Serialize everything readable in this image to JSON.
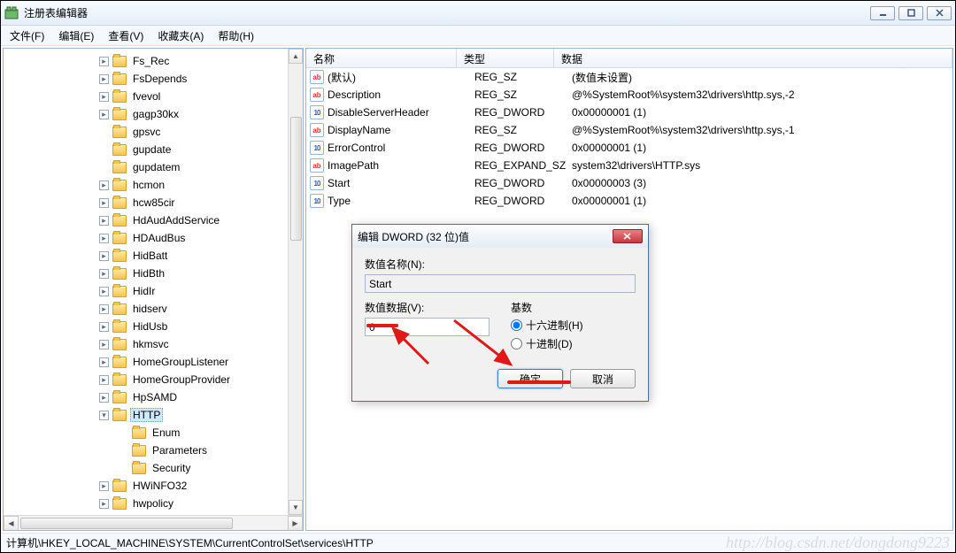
{
  "window": {
    "title": "注册表编辑器",
    "menu": [
      "文件(F)",
      "编辑(E)",
      "查看(V)",
      "收藏夹(A)",
      "帮助(H)"
    ]
  },
  "tree": {
    "items": [
      {
        "label": "Fs_Rec",
        "exp": "+"
      },
      {
        "label": "FsDepends",
        "exp": "+"
      },
      {
        "label": "fvevol",
        "exp": "+"
      },
      {
        "label": "gagp30kx",
        "exp": "+"
      },
      {
        "label": "gpsvc",
        "exp": ""
      },
      {
        "label": "gupdate",
        "exp": ""
      },
      {
        "label": "gupdatem",
        "exp": ""
      },
      {
        "label": "hcmon",
        "exp": "+"
      },
      {
        "label": "hcw85cir",
        "exp": "+"
      },
      {
        "label": "HdAudAddService",
        "exp": "+"
      },
      {
        "label": "HDAudBus",
        "exp": "+"
      },
      {
        "label": "HidBatt",
        "exp": "+"
      },
      {
        "label": "HidBth",
        "exp": "+"
      },
      {
        "label": "HidIr",
        "exp": "+"
      },
      {
        "label": "hidserv",
        "exp": "+"
      },
      {
        "label": "HidUsb",
        "exp": "+"
      },
      {
        "label": "hkmsvc",
        "exp": "+"
      },
      {
        "label": "HomeGroupListener",
        "exp": "+"
      },
      {
        "label": "HomeGroupProvider",
        "exp": "+"
      },
      {
        "label": "HpSAMD",
        "exp": "+"
      },
      {
        "label": "HTTP",
        "exp": "-",
        "selected": true
      },
      {
        "label": "HWiNFO32",
        "exp": "+"
      },
      {
        "label": "hwpolicy",
        "exp": "+"
      }
    ],
    "children": [
      "Enum",
      "Parameters",
      "Security"
    ]
  },
  "grid": {
    "headers": {
      "name": "名称",
      "type": "类型",
      "data": "数据"
    },
    "rows": [
      {
        "ic": "sz",
        "name": "(默认)",
        "type": "REG_SZ",
        "data": "(数值未设置)"
      },
      {
        "ic": "sz",
        "name": "Description",
        "type": "REG_SZ",
        "data": "@%SystemRoot%\\system32\\drivers\\http.sys,-2"
      },
      {
        "ic": "dw",
        "name": "DisableServerHeader",
        "type": "REG_DWORD",
        "data": "0x00000001 (1)"
      },
      {
        "ic": "sz",
        "name": "DisplayName",
        "type": "REG_SZ",
        "data": "@%SystemRoot%\\system32\\drivers\\http.sys,-1"
      },
      {
        "ic": "dw",
        "name": "ErrorControl",
        "type": "REG_DWORD",
        "data": "0x00000001 (1)"
      },
      {
        "ic": "sz",
        "name": "ImagePath",
        "type": "REG_EXPAND_SZ",
        "data": "system32\\drivers\\HTTP.sys"
      },
      {
        "ic": "dw",
        "name": "Start",
        "type": "REG_DWORD",
        "data": "0x00000003 (3)"
      },
      {
        "ic": "dw",
        "name": "Type",
        "type": "REG_DWORD",
        "data": "0x00000001 (1)"
      }
    ]
  },
  "dialog": {
    "title": "编辑 DWORD (32 位)值",
    "name_label": "数值名称(N):",
    "name_value": "Start",
    "data_label": "数值数据(V):",
    "data_value": "0",
    "base_label": "基数",
    "hex": "十六进制(H)",
    "dec": "十进制(D)",
    "ok": "确定",
    "cancel": "取消"
  },
  "statusbar": {
    "path": "计算机\\HKEY_LOCAL_MACHINE\\SYSTEM\\CurrentControlSet\\services\\HTTP",
    "watermark": "http://blog.csdn.net/dongdong9223"
  },
  "icons": {
    "sz": "ab",
    "dw": "011\n110"
  }
}
